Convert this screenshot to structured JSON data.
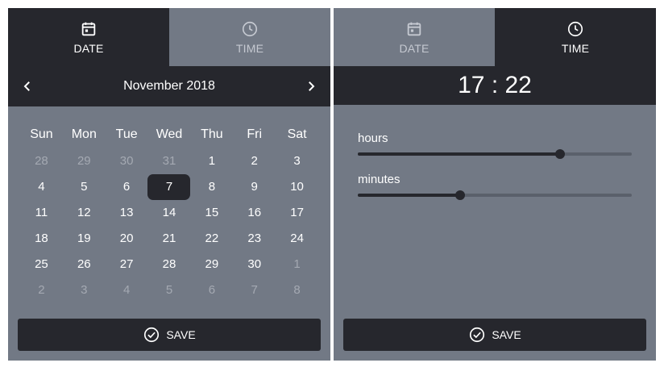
{
  "date_picker": {
    "tabs": {
      "date_label": "DATE",
      "time_label": "TIME"
    },
    "month_title": "November 2018",
    "weekdays": [
      "Sun",
      "Mon",
      "Tue",
      "Wed",
      "Thu",
      "Fri",
      "Sat"
    ],
    "weeks": [
      [
        "28",
        "29",
        "30",
        "31",
        "1",
        "2",
        "3"
      ],
      [
        "4",
        "5",
        "6",
        "7",
        "8",
        "9",
        "10"
      ],
      [
        "11",
        "12",
        "13",
        "14",
        "15",
        "16",
        "17"
      ],
      [
        "18",
        "19",
        "20",
        "21",
        "22",
        "23",
        "24"
      ],
      [
        "25",
        "26",
        "27",
        "28",
        "29",
        "30",
        "1"
      ],
      [
        "2",
        "3",
        "4",
        "5",
        "6",
        "7",
        "8"
      ]
    ],
    "selected_day": "7",
    "save_label": "SAVE"
  },
  "time_picker": {
    "tabs": {
      "date_label": "DATE",
      "time_label": "TIME"
    },
    "time_display": "17 : 22",
    "hours_label": "hours",
    "hours_value": 17,
    "hours_max": 23,
    "minutes_label": "minutes",
    "minutes_value": 22,
    "minutes_max": 59,
    "save_label": "SAVE"
  },
  "colors": {
    "dark": "#26272d",
    "panel": "#727985",
    "muted_text": "#a4a9b2",
    "slider_track": "#5a606b"
  },
  "icons": {
    "date_tab": "calendar-icon",
    "time_tab": "clock-icon",
    "prev": "chevron-left-icon",
    "next": "chevron-right-icon",
    "save": "check-circle-icon"
  }
}
